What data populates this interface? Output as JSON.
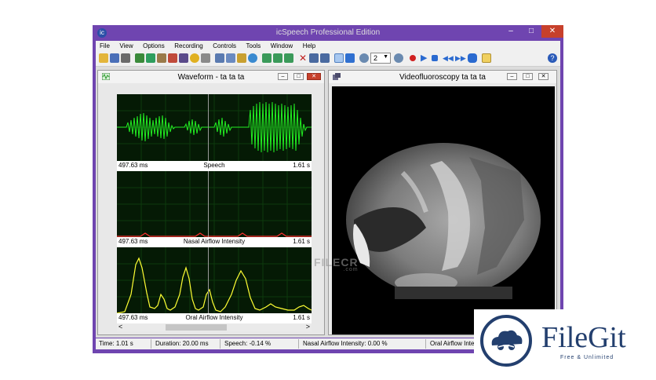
{
  "window": {
    "title": "icSpeech Professional Edition",
    "icon": "app-logo-icon"
  },
  "menu": [
    "File",
    "View",
    "Options",
    "Recording",
    "Controls",
    "Tools",
    "Window",
    "Help"
  ],
  "toolbar": {
    "zoom_value": "2"
  },
  "waveform_window": {
    "title": "Waveform - ta ta ta",
    "panes": [
      {
        "left": "497.63 ms",
        "label": "Speech",
        "right": "1.61 s"
      },
      {
        "left": "497.63 ms",
        "label": "Nasal Airflow Intensity",
        "right": "1.61 s"
      },
      {
        "left": "497.63 ms",
        "label": "Oral Airflow Intensity",
        "right": "1.61 s"
      }
    ],
    "scroll_left": "<",
    "scroll_right": ">"
  },
  "video_window": {
    "title": "Videofluoroscopy ta ta ta"
  },
  "status": {
    "time": "Time: 1.01 s",
    "duration": "Duration: 20.00 ms",
    "speech": "Speech: -0.14 %",
    "nasal": "Nasal Airflow Intensity: 0.00 %",
    "oral": "Oral Airflow Inte"
  },
  "watermark": {
    "main": "FILECR",
    "sub": ".com"
  },
  "badge": {
    "name": "FileGit",
    "tagline": "Free & Unlimited"
  },
  "colors": {
    "frame": "#6f45b0",
    "signal_speech": "#22ee22",
    "signal_nasal": "#ff3030",
    "signal_oral": "#ffff33",
    "plot_bg": "#051a05"
  }
}
